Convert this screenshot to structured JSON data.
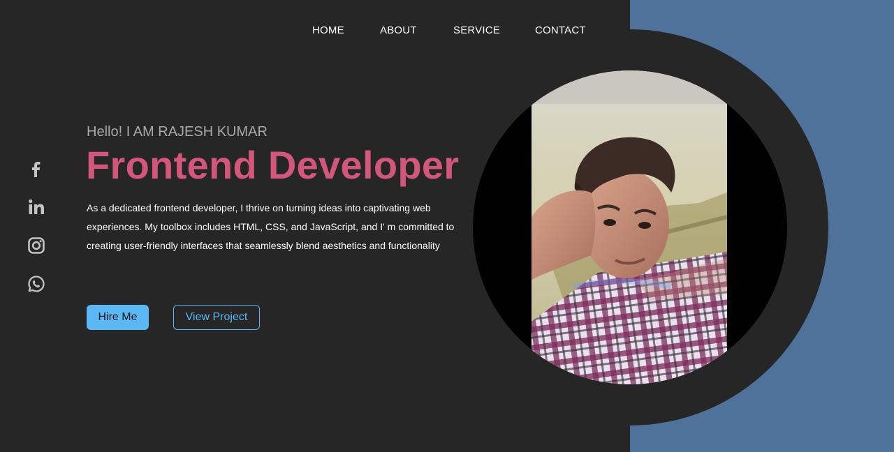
{
  "nav": {
    "items": [
      {
        "label": "HOME"
      },
      {
        "label": "ABOUT"
      },
      {
        "label": "SERVICE"
      },
      {
        "label": "CONTACT"
      }
    ]
  },
  "social": {
    "icons": [
      "facebook-icon",
      "linkedin-icon",
      "instagram-icon",
      "whatsapp-icon"
    ]
  },
  "hero": {
    "greeting": "Hello! I AM RAJESH KUMAR",
    "title": "Frontend Developer",
    "description": "As a dedicated frontend developer, I thrive on turning ideas into captivating web experiences. My toolbox includes HTML, CSS, and JavaScript, and I' m committed to creating user-friendly interfaces that seamlessly blend aesthetics and functionality",
    "hire_label": "Hire Me",
    "project_label": "View Project"
  },
  "colors": {
    "background": "#262626",
    "accent_pink": "#d2577a",
    "accent_blue": "#5cb8f4",
    "panel_blue": "#4e7299"
  }
}
